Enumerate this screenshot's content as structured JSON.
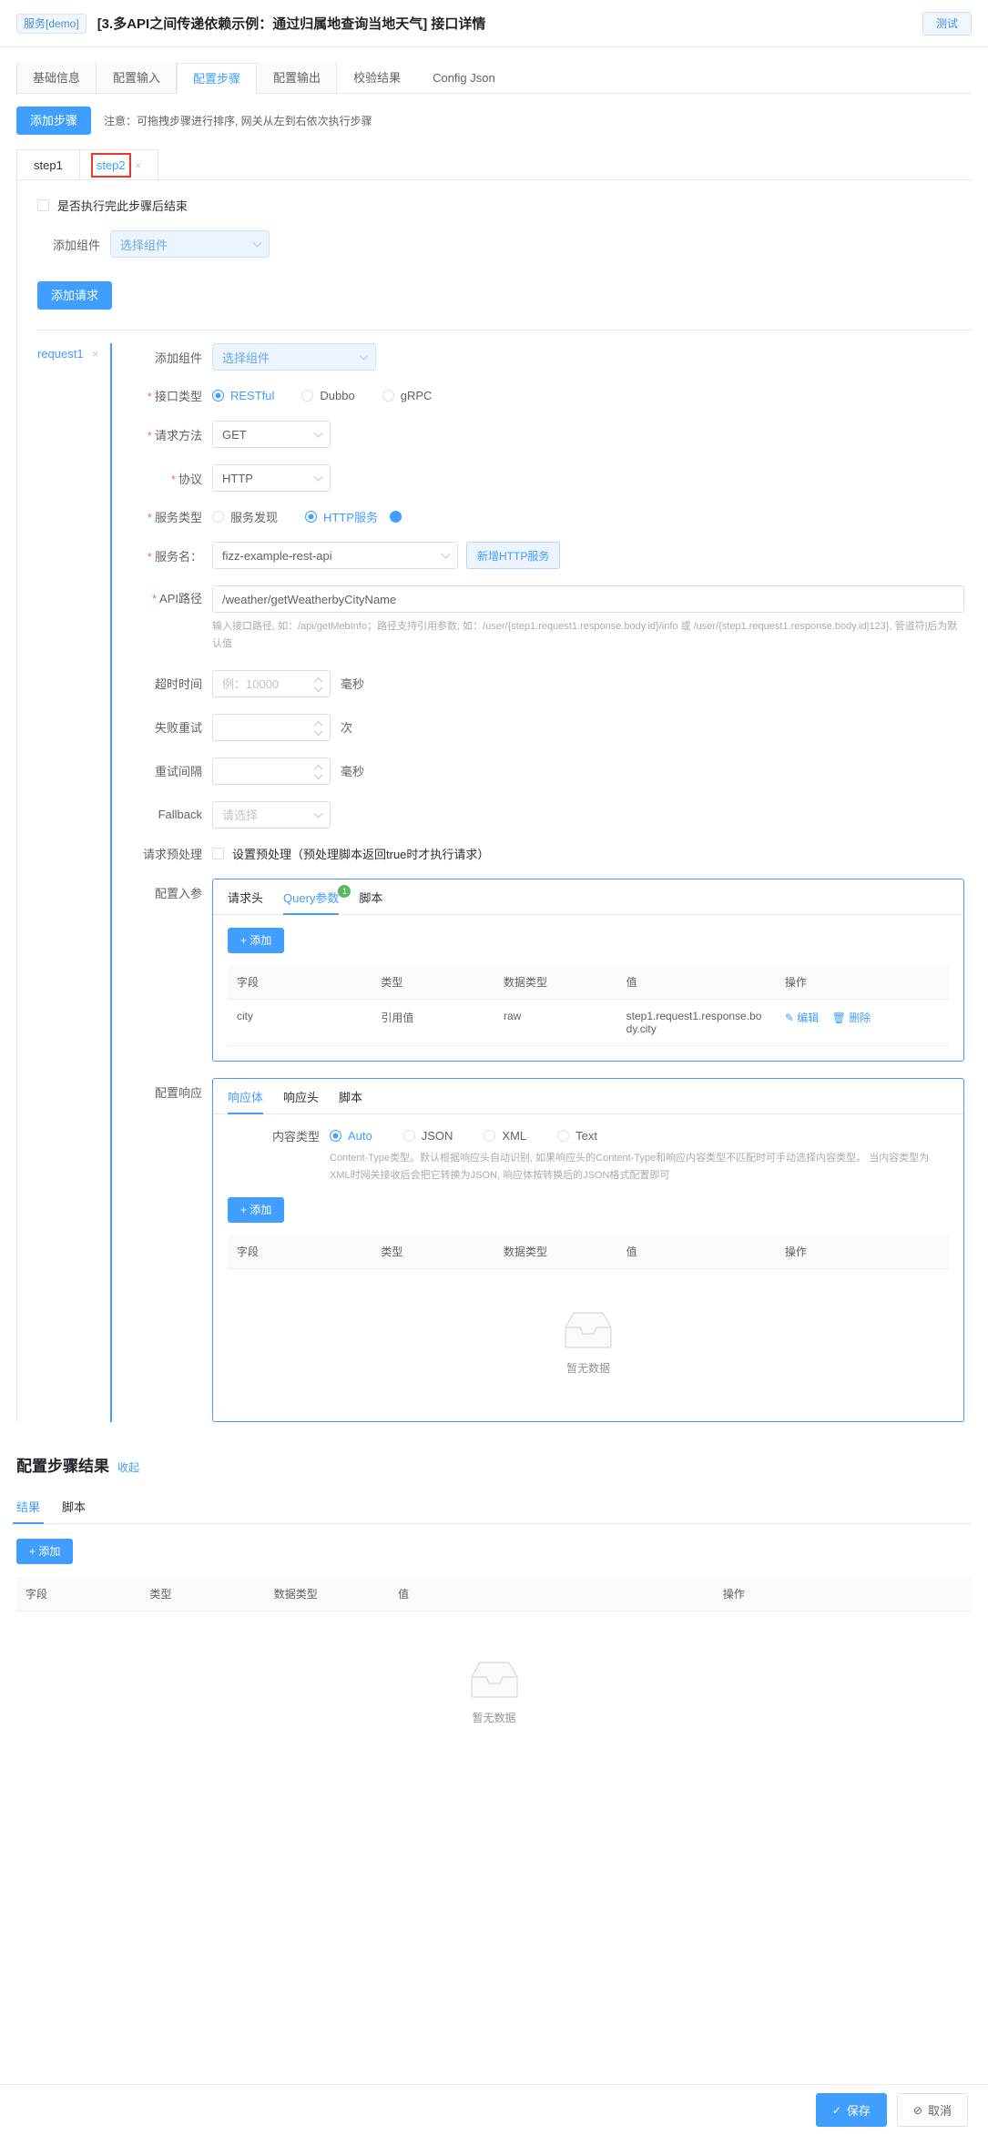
{
  "header": {
    "service_tag": "服务[demo]",
    "title": "[3.多API之间传递依赖示例：通过归属地查询当地天气] 接口详情",
    "test_button": "测试"
  },
  "main_tabs": [
    {
      "label": "基础信息",
      "active": false
    },
    {
      "label": "配置输入",
      "active": false
    },
    {
      "label": "配置步骤",
      "active": true
    },
    {
      "label": "配置输出",
      "active": false
    },
    {
      "label": "校验结果",
      "active": false
    },
    {
      "label": "Config Json",
      "active": false
    }
  ],
  "steps_section": {
    "add_step_button": "添加步骤",
    "note": "注意：可拖拽步骤进行排序, 网关从左到右依次执行步骤",
    "step_tabs": [
      {
        "label": "step1",
        "active": false,
        "closable": false
      },
      {
        "label": "step2",
        "active": true,
        "closable": true
      }
    ],
    "close_glyph": "×",
    "end_after_step_label": "是否执行完此步骤后结束",
    "add_component_label": "添加组件",
    "component_placeholder": "选择组件",
    "add_request_button": "添加请求"
  },
  "request": {
    "tab_label": "request1",
    "close_glyph": "×",
    "add_component_label": "添加组件",
    "component_placeholder": "选择组件",
    "interface_type": {
      "label": "接口类型",
      "options": [
        "RESTful",
        "Dubbo",
        "gRPC"
      ],
      "selected": "RESTful"
    },
    "method": {
      "label": "请求方法",
      "value": "GET"
    },
    "protocol": {
      "label": "协议",
      "value": "HTTP"
    },
    "service_type": {
      "label": "服务类型",
      "options": [
        "服务发现",
        "HTTP服务"
      ],
      "selected": "HTTP服务",
      "help_glyph": "?"
    },
    "service_name": {
      "label": "服务名：",
      "value": "fizz-example-rest-api",
      "new_http_service_button": "新增HTTP服务"
    },
    "api_path": {
      "label": "API路径",
      "value": "/weather/getWeatherbyCityName",
      "hint": "输入接口路径, 如：/api/getMebInfo；路径支持引用参数, 如：/user/{step1.request1.response.body.id}/info 或 /user/{step1.request1.response.body.id|123}, 管道符|后为默认值"
    },
    "timeout": {
      "label": "超时时间",
      "placeholder": "例：10000",
      "value": "",
      "unit": "毫秒"
    },
    "retry": {
      "label": "失败重试",
      "placeholder": "",
      "value": "",
      "unit": "次"
    },
    "retry_interval": {
      "label": "重试间隔",
      "placeholder": "",
      "value": "",
      "unit": "毫秒"
    },
    "fallback": {
      "label": "Fallback",
      "placeholder": "请选择",
      "value": ""
    },
    "preprocess": {
      "label": "请求预处理",
      "checkbox_label": "设置预处理（预处理脚本返回true时才执行请求）",
      "checked": false
    }
  },
  "input_params": {
    "label": "配置入参",
    "tabs": [
      {
        "label": "请求头",
        "active": false,
        "badge": ""
      },
      {
        "label": "Query参数",
        "active": true,
        "badge": "1"
      },
      {
        "label": "脚本",
        "active": false,
        "badge": ""
      }
    ],
    "add_button": "添加",
    "add_glyph": "+",
    "columns": [
      "字段",
      "类型",
      "数据类型",
      "值",
      "操作"
    ],
    "rows": [
      {
        "field": "city",
        "type": "引用值",
        "data_type": "raw",
        "value": "step1.request1.response.body.city",
        "actions": [
          {
            "label": "编辑",
            "glyph": "✎"
          },
          {
            "label": "删除",
            "glyph": "🗑"
          }
        ]
      }
    ]
  },
  "response_config": {
    "label": "配置响应",
    "tabs": [
      {
        "label": "响应体",
        "active": true
      },
      {
        "label": "响应头",
        "active": false
      },
      {
        "label": "脚本",
        "active": false
      }
    ],
    "content_type": {
      "label": "内容类型",
      "options": [
        "Auto",
        "JSON",
        "XML",
        "Text"
      ],
      "selected": "Auto",
      "hint": "Content-Type类型。默认根据响应头自动识别, 如果响应头的Content-Type和响应内容类型不匹配时可手动选择内容类型。 当内容类型为XML时网关接收后会把它转换为JSON, 响应体按转换后的JSON格式配置即可"
    },
    "add_button": "添加",
    "add_glyph": "+",
    "columns": [
      "字段",
      "类型",
      "数据类型",
      "值",
      "操作"
    ],
    "rows": [],
    "empty_text": "暂无数据"
  },
  "step_result": {
    "title": "配置步骤结果",
    "collapse_link": "收起",
    "tabs": [
      {
        "label": "结果",
        "active": true
      },
      {
        "label": "脚本",
        "active": false
      }
    ],
    "add_button": "添加",
    "add_glyph": "+",
    "columns": [
      "字段",
      "类型",
      "数据类型",
      "值",
      "操作"
    ],
    "rows": [],
    "empty_text": "暂无数据"
  },
  "footer": {
    "save_button": "保存",
    "save_glyph": "✓",
    "cancel_button": "取消",
    "cancel_glyph": "⊘"
  }
}
